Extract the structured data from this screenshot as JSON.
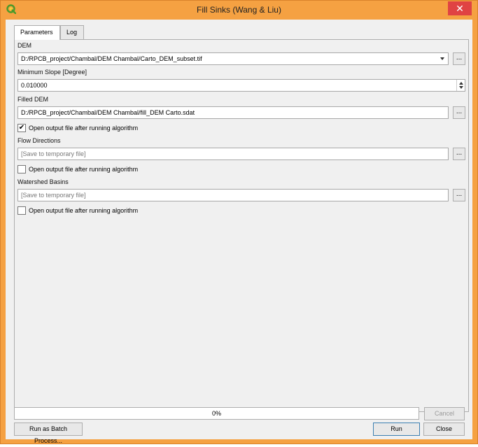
{
  "window": {
    "title": "Fill Sinks (Wang & Liu)",
    "close_glyph": "✕",
    "titlebar_color": "#f5a142",
    "app_icon": "qgis-logo-icon"
  },
  "tabs": [
    {
      "label": "Parameters",
      "active": true
    },
    {
      "label": "Log",
      "active": false
    }
  ],
  "params": {
    "dem": {
      "label": "DEM",
      "value": "D:/RPCB_project/Chambal/DEM Chambal/Carto_DEM_subset.tif"
    },
    "min_slope": {
      "label": "Minimum Slope [Degree]",
      "value": "0.010000"
    },
    "filled_dem": {
      "label": "Filled DEM",
      "value": "D:/RPCB_project/Chambal/DEM Chambal/fill_DEM Carto.sdat",
      "open_label": "Open output file after running algorithm",
      "open_checked": true
    },
    "flow_dir": {
      "label": "Flow Directions",
      "placeholder": "[Save to temporary file]",
      "open_label": "Open output file after running algorithm",
      "open_checked": false
    },
    "watershed": {
      "label": "Watershed Basins",
      "placeholder": "[Save to temporary file]",
      "open_label": "Open output file after running algorithm",
      "open_checked": false
    },
    "browse_label": "..."
  },
  "progress": {
    "text": "0%",
    "value": 0
  },
  "buttons": {
    "cancel": "Cancel",
    "batch": "Run as Batch Process...",
    "run": "Run",
    "close": "Close"
  }
}
